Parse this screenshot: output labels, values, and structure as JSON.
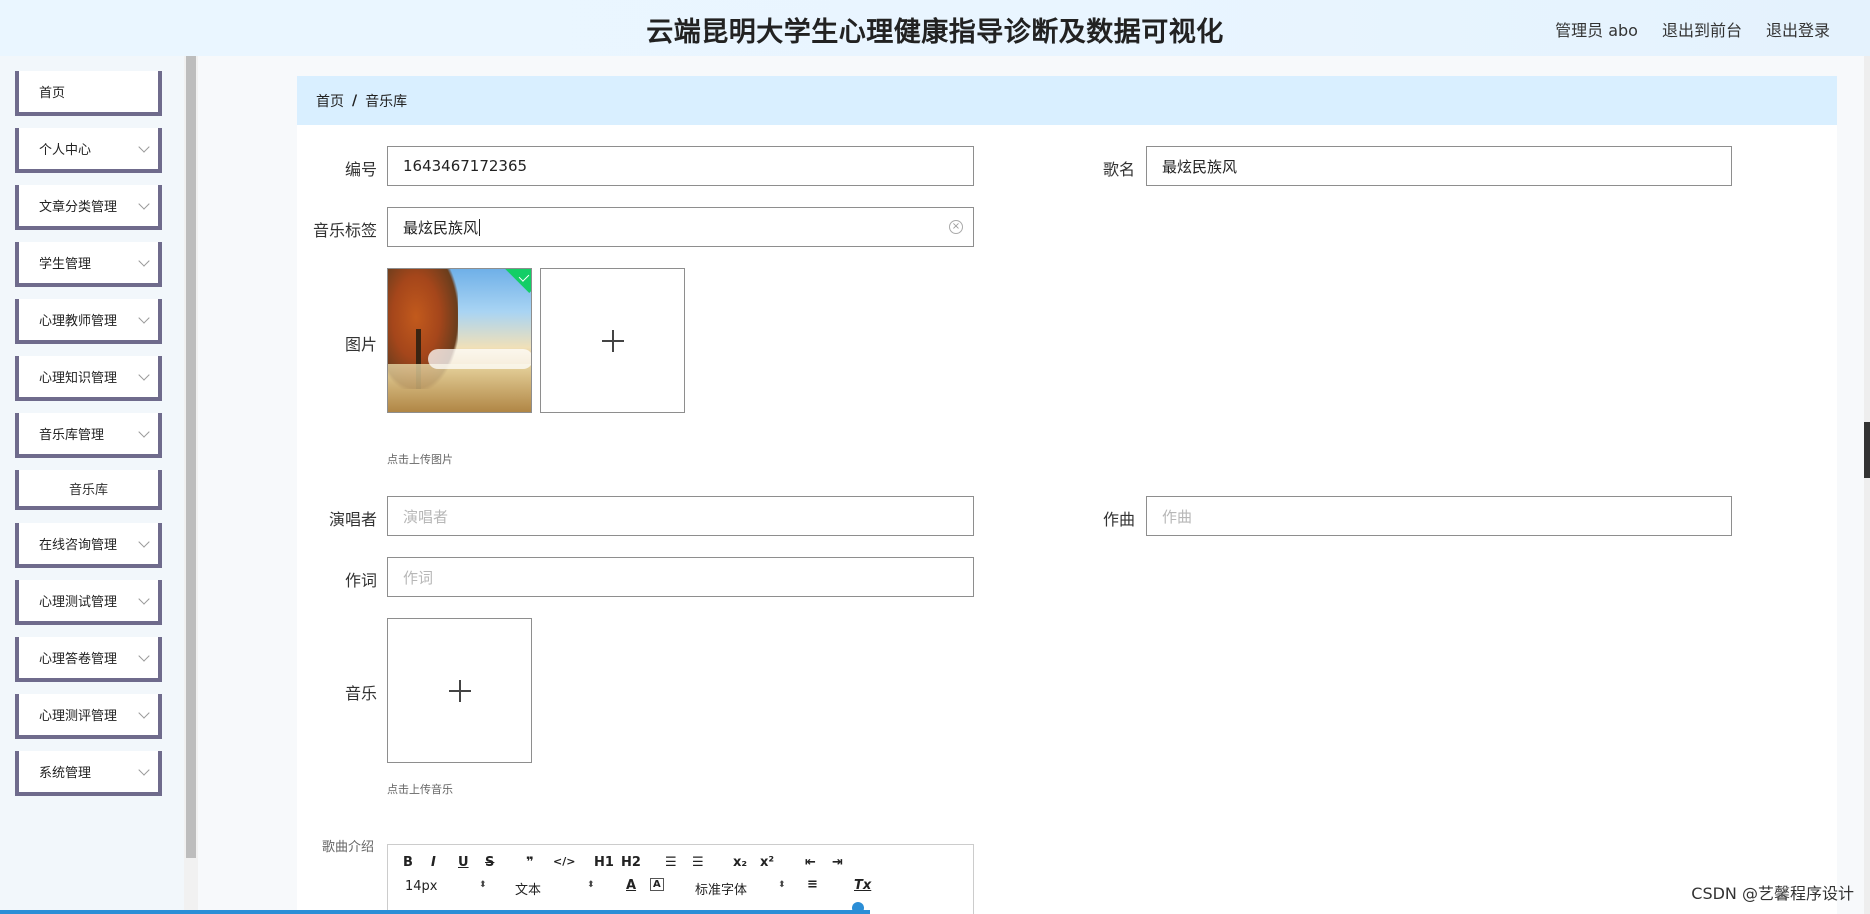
{
  "header": {
    "title": "云端昆明大学生心理健康指导诊断及数据可视化",
    "user": "管理员 abo",
    "to_front": "退出到前台",
    "logout": "退出登录"
  },
  "sidebar": {
    "items": [
      {
        "label": "首页"
      },
      {
        "label": "个人中心"
      },
      {
        "label": "文章分类管理"
      },
      {
        "label": "学生管理"
      },
      {
        "label": "心理教师管理"
      },
      {
        "label": "心理知识管理"
      },
      {
        "label": "音乐库管理"
      },
      {
        "label": "在线咨询管理"
      },
      {
        "label": "心理测试管理"
      },
      {
        "label": "心理答卷管理"
      },
      {
        "label": "心理测评管理"
      },
      {
        "label": "系统管理"
      }
    ],
    "sub_item": "音乐库"
  },
  "breadcrumb": {
    "home": "首页",
    "sep": "/",
    "current": "音乐库"
  },
  "form": {
    "number_label": "编号",
    "number_value": "1643467172365",
    "song_label": "歌名",
    "song_value": "最炫民族风",
    "tag_label": "音乐标签",
    "tag_value": "最炫民族风",
    "image_label": "图片",
    "image_hint": "点击上传图片",
    "singer_label": "演唱者",
    "singer_placeholder": "演唱者",
    "composer_label": "作曲",
    "composer_placeholder": "作曲",
    "lyricist_label": "作词",
    "lyricist_placeholder": "作词",
    "music_label": "音乐",
    "music_hint": "点击上传音乐",
    "intro_label": "歌曲介绍"
  },
  "editor": {
    "bold": "B",
    "italic": "I",
    "underline": "U",
    "strike": "S",
    "quote": "❞",
    "code": "</>",
    "h1": "H1",
    "h2": "H2",
    "ol": "☰",
    "ul": "☰",
    "sub": "x₂",
    "sup": "x²",
    "outdent": "⇤",
    "indent": "⇥",
    "size": "14px",
    "format": "文本",
    "color": "A",
    "bg": "A",
    "font": "标准字体",
    "align": "≡",
    "clean": "Tx"
  },
  "watermark": "CSDN @艺馨程序设计"
}
